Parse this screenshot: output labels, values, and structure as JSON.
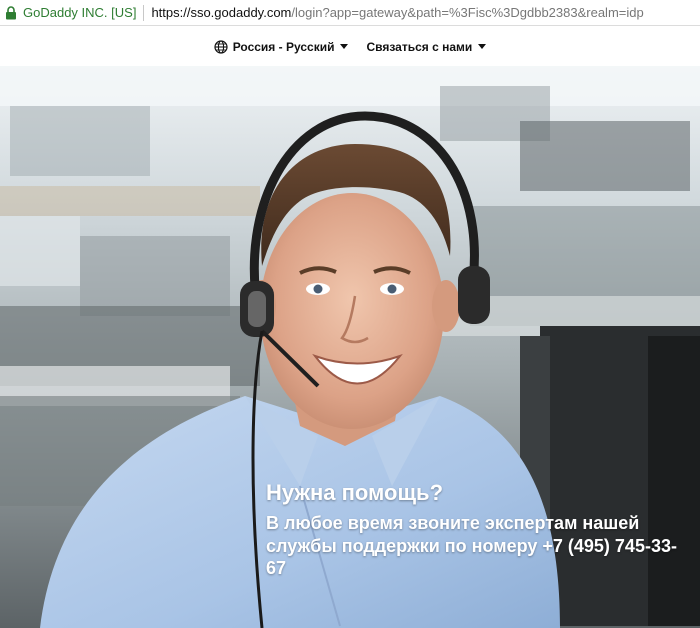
{
  "browser": {
    "site_identity": "GoDaddy INC. [US]",
    "url_host": "https://sso.godaddy.com",
    "url_rest": "/login?app=gateway&path=%3Fisc%3Dgdbb2383&realm=idp"
  },
  "nav": {
    "language_label": "Россия - Русский",
    "contact_label": "Связаться с нами"
  },
  "hero": {
    "title": "Нужна помощь?",
    "text": "В любое время звоните экспертам нашей службы поддержки по номеру +7 (495) 745-33-67"
  },
  "colors": {
    "secure_green": "#2e7d32",
    "shirt_blue": "#a9c4e6"
  },
  "icons": [
    "lock-icon",
    "globe-icon",
    "chevron-down-icon"
  ]
}
